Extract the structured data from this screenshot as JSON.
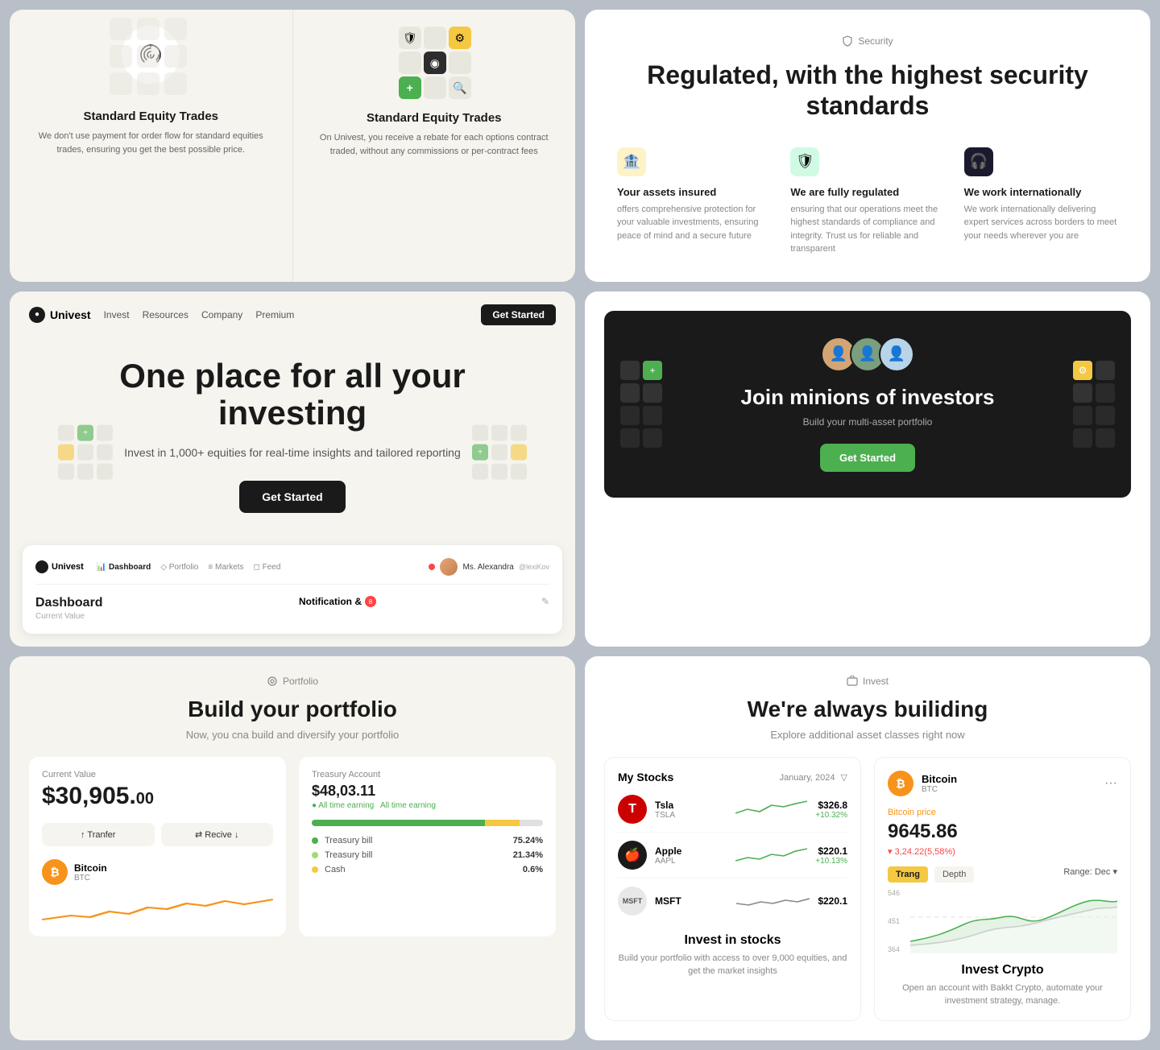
{
  "topLeft": {
    "section1": {
      "title": "Standard Equity Trades",
      "desc": "We don't use payment for order flow for standard equities trades, ensuring you get the best possible price."
    },
    "section2": {
      "title": "Standard Equity Trades",
      "desc": "On Univest, you receive a rebate for each options contract traded, without any commissions or per-contract fees"
    }
  },
  "topRight": {
    "securityLabel": "Security",
    "title": "Regulated, with the highest security standards",
    "features": [
      {
        "icon": "🏦",
        "iconStyle": "yellow",
        "title": "Your assets insured",
        "desc": "offers comprehensive protection for your valuable investments, ensuring peace of mind and a secure future"
      },
      {
        "icon": "🛡",
        "iconStyle": "green",
        "title": "We are fully regulated",
        "desc": "ensuring that our operations meet the highest standards of compliance and integrity. Trust us for reliable and transparent"
      },
      {
        "icon": "🎧",
        "iconStyle": "dark",
        "title": "We work internationally",
        "desc": "We work internationally delivering expert services across borders to meet your needs wherever you are"
      }
    ]
  },
  "midLeft": {
    "nav": {
      "logo": "Univest",
      "links": [
        "Invest",
        "Resources",
        "Company",
        "Premium"
      ],
      "cta": "Get Started"
    },
    "hero": {
      "title": "One place for all your investing",
      "subtitle": "Invest in 1,000+ equities for real-time insights and tailored reporting",
      "cta": "Get Started"
    },
    "dashboard": {
      "logo": "Univest",
      "navItems": [
        "Dashboard",
        "Portfolio",
        "Markets",
        "Feed"
      ],
      "user": {
        "name": "Ms. Alexandra",
        "handle": "@lexiKov"
      },
      "sectionTitle": "Dashboard",
      "sectionSub": "Current Value",
      "notification": "Notification &",
      "notificationBadge": "8"
    }
  },
  "midRight": {
    "darkBanner": {
      "title": "Join minions of investors",
      "subtitle": "Build your multi-asset portfolio",
      "cta": "Get Started"
    }
  },
  "botLeft": {
    "label": "Portfolio",
    "title": "Build your portfolio",
    "subtitle": "Now, you cna build and diversify your portfolio",
    "currentValueLabel": "Current Value",
    "currentValue": "$30,905.",
    "currentValueDecimal": "00",
    "actions": [
      "↑ Tranfer",
      "⇄ Recive ↓"
    ],
    "btc": {
      "name": "Bitcoin",
      "ticker": "BTC"
    },
    "treasury": {
      "title": "Treasury Account",
      "amount": "$48,03.11",
      "earningLabel": "• All time earning All time earning",
      "items": [
        {
          "label": "Treasury bill",
          "pct": "75.24%",
          "color": "#4caf50"
        },
        {
          "label": "Treasury bill",
          "pct": "21.34%",
          "color": "#a3d977"
        },
        {
          "label": "Cash",
          "pct": "0.6%",
          "color": "#f5c842"
        }
      ]
    }
  },
  "botRight": {
    "label": "Invest",
    "title": "We're always builiding",
    "subtitle": "Explore additional asset classes right now",
    "stocks": {
      "title": "My Stocks",
      "date": "January, 2024",
      "items": [
        {
          "name": "Tsla",
          "ticker": "TSLA",
          "price": "$326.8",
          "change": "+10.32%",
          "positive": true
        },
        {
          "name": "Apple",
          "ticker": "AAPL",
          "price": "$220.1",
          "change": "+10.13%",
          "positive": true
        },
        {
          "name": "MSFT",
          "ticker": "",
          "price": "$220.1",
          "change": "",
          "positive": false
        }
      ],
      "investTitle": "Invest in stocks",
      "investDesc": "Build your portfolio with access to over 9,000 equities, and get the market insights"
    },
    "crypto": {
      "name": "Bitcoin",
      "symbol": "BTC",
      "priceLabel": "Bitcoin price",
      "price": "9645.86",
      "change": "▾ 3,24.22(5,58%)",
      "tabs": [
        "Trang",
        "Depth"
      ],
      "rangeLabel": "Range:",
      "rangeValue": "Dec",
      "investTitle": "Invest Crypto",
      "investDesc": "Open an account with Bakkt Crypto, automate your investment strategy, manage."
    }
  }
}
